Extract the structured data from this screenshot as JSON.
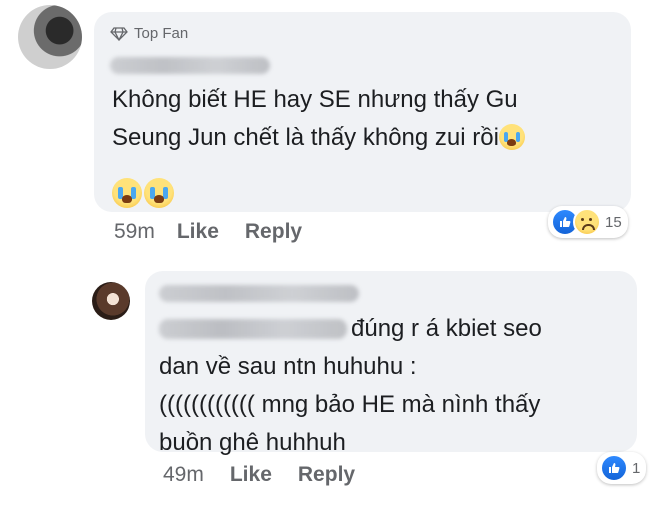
{
  "comment": {
    "badge": "Top Fan",
    "text_line1": "Không biết HE hay SE nhưng thấy Gu",
    "text_line2": "Seung Jun chết là thấy không zui rồi",
    "time": "59m",
    "like_label": "Like",
    "reply_label": "Reply",
    "reaction_count": "15",
    "reaction_icons": [
      "like-icon",
      "sad-icon"
    ],
    "emojis": [
      "loudly-crying-face",
      "loudly-crying-face",
      "loudly-crying-face"
    ]
  },
  "reply": {
    "text_part1": "đúng r á kbiet seo",
    "text_line2": "dan về sau ntn huhuhu :",
    "text_line3": "(((((((((((( mng bảo HE mà nình thấy",
    "text_line4": "buồn ghê huhhuh",
    "time": "49m",
    "like_label": "Like",
    "reply_label": "Reply",
    "reaction_count": "1",
    "reaction_icons": [
      "like-icon"
    ]
  },
  "colors": {
    "bubble": "#f0f2f5",
    "meta": "#65676b",
    "like_blue": "#1877f2"
  }
}
